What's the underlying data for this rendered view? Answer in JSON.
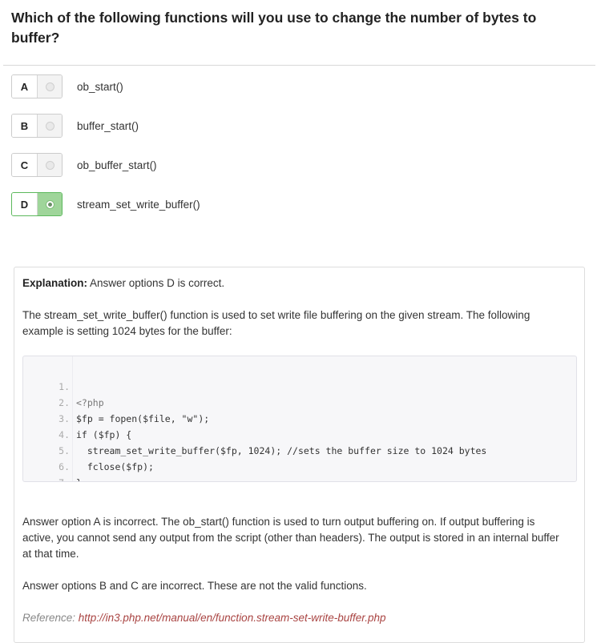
{
  "question": {
    "text": "Which of the following functions will you use to change the number of bytes to buffer?"
  },
  "options": [
    {
      "letter": "A",
      "text": "ob_start()",
      "selected": false
    },
    {
      "letter": "B",
      "text": "buffer_start()",
      "selected": false
    },
    {
      "letter": "C",
      "text": "ob_buffer_start()",
      "selected": false
    },
    {
      "letter": "D",
      "text": "stream_set_write_buffer()",
      "selected": true
    }
  ],
  "explanation": {
    "label": "Explanation:",
    "summary": " Answer options D is correct.",
    "intro": "The stream_set_write_buffer() function is used to set write file buffering on the given stream. The following example is setting 1024 bytes for the buffer:",
    "code_lines": [
      {
        "num": "1.",
        "text": "<?php"
      },
      {
        "num": "2.",
        "text": "$fp = fopen($file, \"w\");"
      },
      {
        "num": "3.",
        "text": "if ($fp) {"
      },
      {
        "num": "4.",
        "text": "  stream_set_write_buffer($fp, 1024); //sets the buffer size to 1024 bytes"
      },
      {
        "num": "5.",
        "text": "  fclose($fp);"
      },
      {
        "num": "6.",
        "text": "}"
      },
      {
        "num": "7.",
        "text": "?>"
      }
    ],
    "option_a": "Answer option A is incorrect. The ob_start() function is used to turn output buffering on. If output buffering is active, you cannot send any output from the script (other than headers). The output is stored in an internal buffer at that time.",
    "options_bc": "Answer options B and C are incorrect. These are not the valid functions.",
    "reference_label": "Reference: ",
    "reference_url": "http://in3.php.net/manual/en/function.stream-set-write-buffer.php"
  },
  "colors": {
    "selected_green": "#9fd59a",
    "reference_link": "#a94442"
  }
}
